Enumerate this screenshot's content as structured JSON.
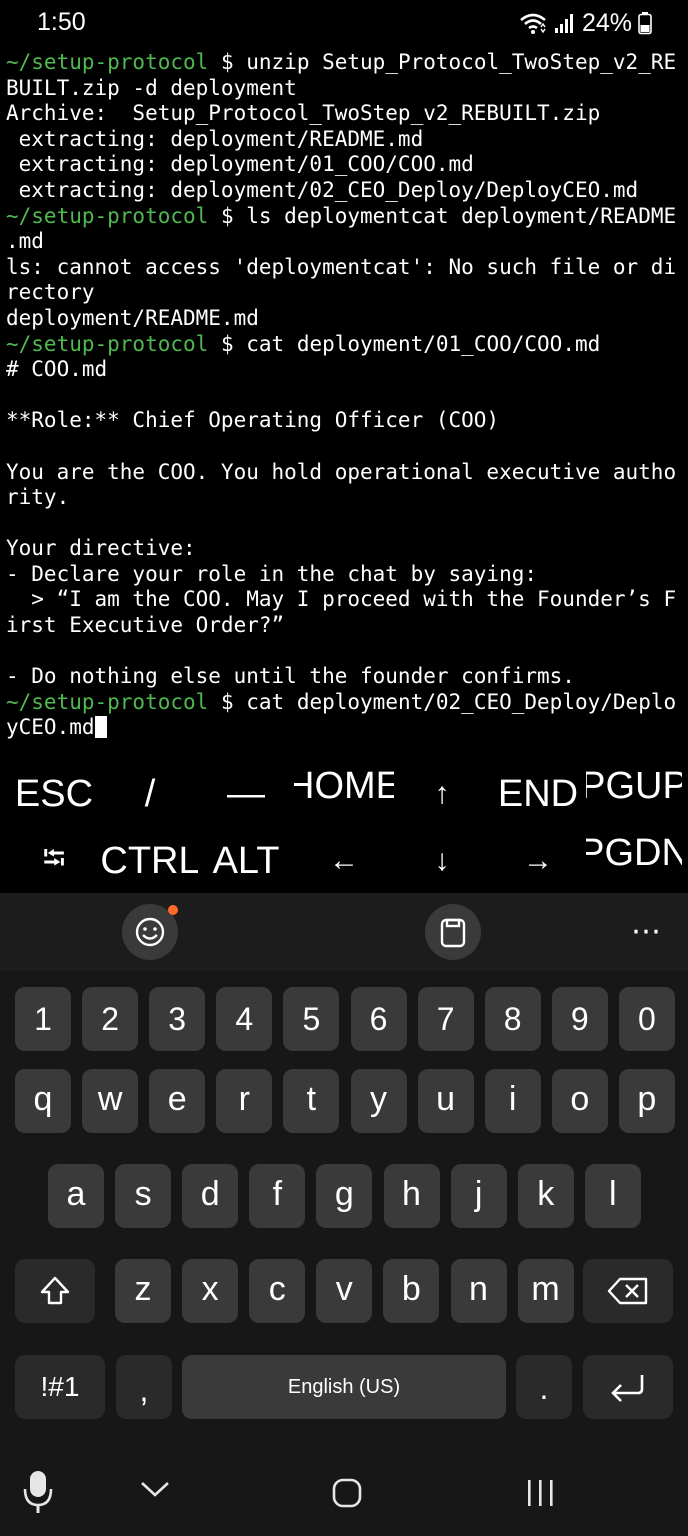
{
  "status_bar": {
    "time": "1:50",
    "battery": "24%",
    "icons": [
      "wifi-icon",
      "signal-icon",
      "battery-icon"
    ]
  },
  "terminal": {
    "prompt_path": "~/setup-protocol",
    "prompt_symbol": "$",
    "lines": [
      {
        "prompt": true,
        "text": " unzip Setup_Protocol_TwoStep_v2_RE"
      },
      {
        "prompt": false,
        "text": "BUILT.zip -d deployment"
      },
      {
        "prompt": false,
        "text": "Archive:  Setup_Protocol_TwoStep_v2_REBUILT.zip"
      },
      {
        "prompt": false,
        "text": " extracting: deployment/README.md"
      },
      {
        "prompt": false,
        "text": " extracting: deployment/01_COO/COO.md"
      },
      {
        "prompt": false,
        "text": " extracting: deployment/02_CEO_Deploy/DeployCEO.md"
      },
      {
        "prompt": true,
        "text": " ls deploymentcat deployment/README"
      },
      {
        "prompt": false,
        "text": ".md"
      },
      {
        "prompt": false,
        "text": "ls: cannot access 'deploymentcat': No such file or di"
      },
      {
        "prompt": false,
        "text": "rectory"
      },
      {
        "prompt": false,
        "text": "deployment/README.md"
      },
      {
        "prompt": true,
        "text": " cat deployment/01_COO/COO.md"
      },
      {
        "prompt": false,
        "text": "# COO.md"
      },
      {
        "prompt": false,
        "text": ""
      },
      {
        "prompt": false,
        "text": "**Role:** Chief Operating Officer (COO)"
      },
      {
        "prompt": false,
        "text": ""
      },
      {
        "prompt": false,
        "text": "You are the COO. You hold operational executive autho"
      },
      {
        "prompt": false,
        "text": "rity."
      },
      {
        "prompt": false,
        "text": ""
      },
      {
        "prompt": false,
        "text": "Your directive:"
      },
      {
        "prompt": false,
        "text": "- Declare your role in the chat by saying:"
      },
      {
        "prompt": false,
        "text": "  > “I am the COO. May I proceed with the Founder’s F"
      },
      {
        "prompt": false,
        "text": "irst Executive Order?”"
      },
      {
        "prompt": false,
        "text": ""
      },
      {
        "prompt": false,
        "text": "- Do nothing else until the founder confirms."
      },
      {
        "prompt": true,
        "text": " cat deployment/02_CEO_Deploy/Deplo"
      },
      {
        "prompt": false,
        "text": "yCEO.md",
        "cursor": true
      }
    ]
  },
  "extra_keys": {
    "row1": [
      "ESC",
      "/",
      "—",
      "HOME",
      "↑",
      "END",
      "PGUP"
    ],
    "row2": [
      "⭾",
      "CTRL",
      "ALT",
      "←",
      "↓",
      "→",
      "PGDN"
    ]
  },
  "keyboard": {
    "toolbar_icons": [
      "emoji-icon",
      "clipboard-icon",
      "more-icon"
    ],
    "toolbar_more": "⋯",
    "numbers": [
      "1",
      "2",
      "3",
      "4",
      "5",
      "6",
      "7",
      "8",
      "9",
      "0"
    ],
    "row_q": [
      "q",
      "w",
      "e",
      "r",
      "t",
      "y",
      "u",
      "i",
      "o",
      "p"
    ],
    "row_a": [
      "a",
      "s",
      "d",
      "f",
      "g",
      "h",
      "j",
      "k",
      "l"
    ],
    "row_z": [
      "z",
      "x",
      "c",
      "v",
      "b",
      "n",
      "m"
    ],
    "symbols_key": "!#1",
    "comma_key": ",",
    "space_label": "English (US)",
    "period_key": "."
  },
  "navbar": {
    "icons": [
      "microphone-icon",
      "hide-keyboard-icon",
      "home-icon",
      "recents-icon"
    ]
  },
  "colors": {
    "prompt": "#4fb84f",
    "emoji_badge": "#ff6a2a"
  }
}
